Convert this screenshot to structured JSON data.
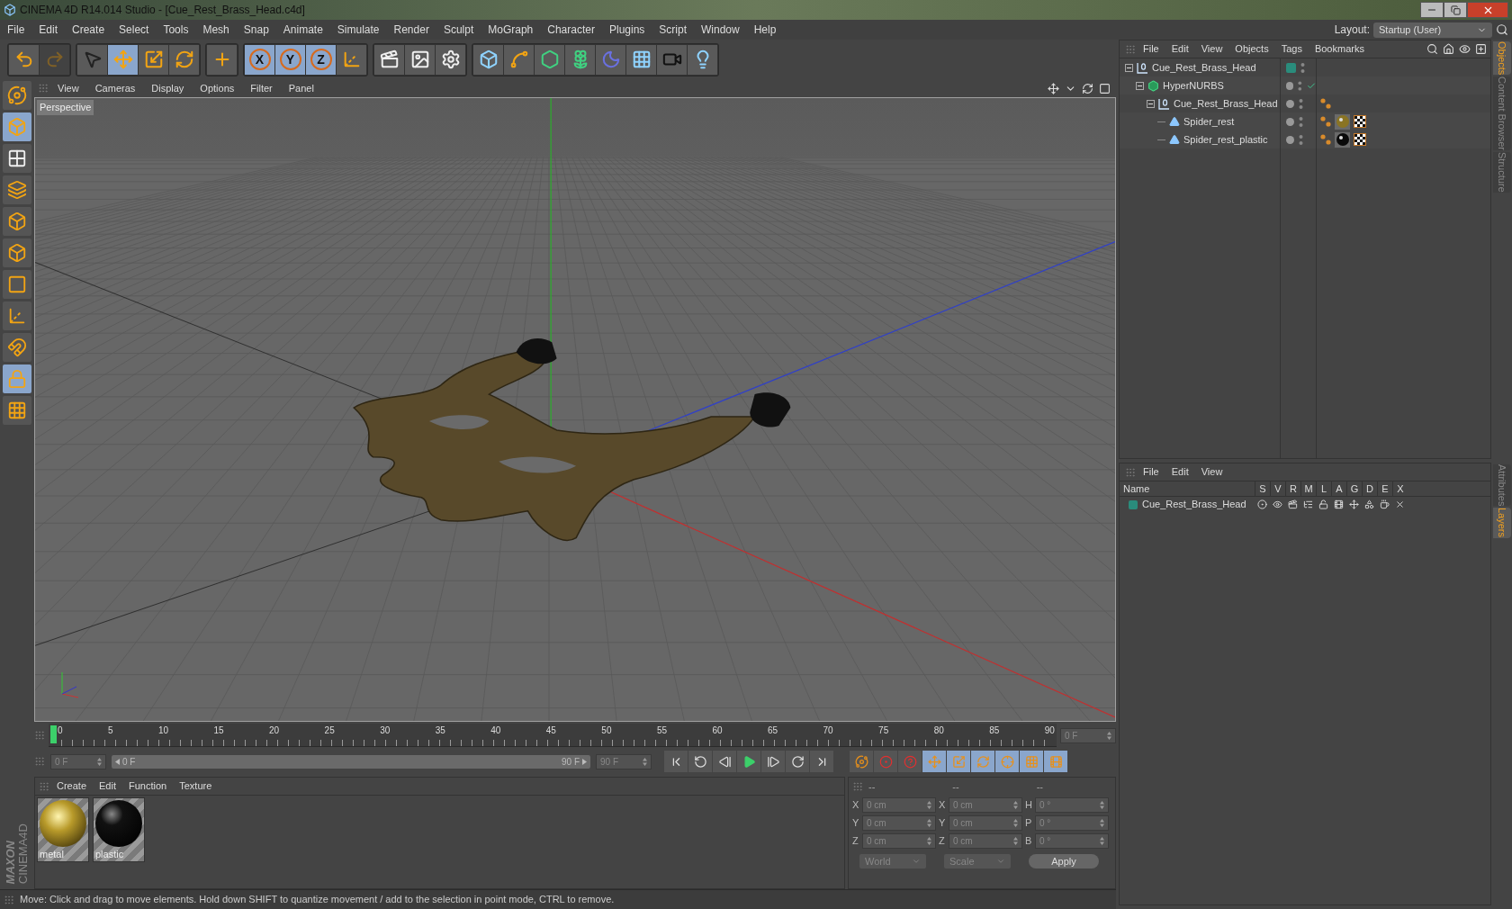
{
  "window": {
    "title": "CINEMA 4D R14.014 Studio - [Cue_Rest_Brass_Head.c4d]"
  },
  "menu": [
    "File",
    "Edit",
    "Create",
    "Select",
    "Tools",
    "Mesh",
    "Snap",
    "Animate",
    "Simulate",
    "Render",
    "Sculpt",
    "MoGraph",
    "Character",
    "Plugins",
    "Script",
    "Window",
    "Help"
  ],
  "layout": {
    "label": "Layout:",
    "value": "Startup (User)"
  },
  "toolbar": [
    [
      {
        "kind": "undo",
        "disabled": false
      },
      {
        "kind": "redo",
        "disabled": true
      }
    ],
    [
      {
        "kind": "select",
        "selected": false
      },
      {
        "kind": "move",
        "selected": true
      },
      {
        "kind": "scale",
        "selected": false
      },
      {
        "kind": "rotate",
        "selected": false
      }
    ],
    [
      {
        "kind": "last_tool",
        "selected": false
      }
    ],
    [
      {
        "kind": "axis",
        "label": "X",
        "selected": true
      },
      {
        "kind": "axis",
        "label": "Y",
        "selected": true
      },
      {
        "kind": "axis",
        "label": "Z",
        "selected": true
      },
      {
        "kind": "coords",
        "selected": false
      }
    ],
    [
      {
        "kind": "render_view",
        "selected": false
      },
      {
        "kind": "render_picture",
        "selected": false
      },
      {
        "kind": "render_settings",
        "selected": false
      }
    ],
    [
      {
        "kind": "cube",
        "selected": false
      },
      {
        "kind": "spline",
        "selected": false
      },
      {
        "kind": "nurbs",
        "selected": false
      },
      {
        "kind": "cloner",
        "selected": false
      },
      {
        "kind": "deformer",
        "selected": false
      },
      {
        "kind": "floor",
        "selected": false
      },
      {
        "kind": "camera",
        "selected": false
      },
      {
        "kind": "light",
        "selected": false
      }
    ]
  ],
  "mode_toolbar": [
    {
      "kind": "make_editable",
      "selected": false
    },
    {
      "kind": "model",
      "selected": true
    },
    {
      "kind": "texture",
      "selected": false
    },
    {
      "kind": "workplane",
      "selected": false
    },
    {
      "kind": "points",
      "selected": false
    },
    {
      "kind": "edges",
      "selected": false
    },
    {
      "kind": "polygons",
      "selected": false
    },
    {
      "kind": "axis",
      "selected": false
    },
    {
      "kind": "snap",
      "selected": false
    },
    {
      "kind": "lock_workplane",
      "selected": true
    },
    {
      "kind": "planar",
      "selected": false
    }
  ],
  "logo": {
    "brand": "MAXON",
    "product": "CINEMA4D"
  },
  "viewport": {
    "menu": [
      "View",
      "Cameras",
      "Display",
      "Options",
      "Filter",
      "Panel"
    ],
    "camera": "Perspective"
  },
  "timeline": {
    "ticks": [
      "0",
      "5",
      "10",
      "15",
      "20",
      "25",
      "30",
      "35",
      "40",
      "45",
      "50",
      "55",
      "60",
      "65",
      "70",
      "75",
      "80",
      "85",
      "90"
    ],
    "level": 0,
    "current_frame": "0 F",
    "start": "0 F",
    "preview_range": {
      "start": "0 F",
      "end": "90 F",
      "level": 1
    },
    "end": "90 F"
  },
  "transport": [
    {
      "kind": "first"
    },
    {
      "kind": "prev_key"
    },
    {
      "kind": "prev_frame"
    },
    {
      "kind": "play"
    },
    {
      "kind": "next_frame"
    },
    {
      "kind": "next_key"
    },
    {
      "kind": "last"
    }
  ],
  "anim_tools": [
    {
      "kind": "motion",
      "selected": false
    },
    {
      "kind": "record",
      "selected": false
    },
    {
      "kind": "help",
      "selected": false
    },
    {
      "kind": "pos",
      "selected": true
    },
    {
      "kind": "scale",
      "selected": true
    },
    {
      "kind": "rot",
      "selected": true
    },
    {
      "kind": "param",
      "selected": true
    },
    {
      "kind": "pla",
      "selected": true
    },
    {
      "kind": "timeline",
      "selected": true
    }
  ],
  "material_manager": {
    "menu": [
      "Create",
      "Edit",
      "Function",
      "Texture"
    ],
    "materials": [
      {
        "name": "metal",
        "kind": "metal"
      },
      {
        "name": "plastic",
        "kind": "plastic"
      }
    ]
  },
  "coordinates": {
    "headers": [
      "--",
      "--",
      "--"
    ],
    "rows": [
      {
        "labels": [
          "X",
          "X",
          "H"
        ],
        "values": [
          "0 cm",
          "0 cm",
          "0 °"
        ]
      },
      {
        "labels": [
          "Y",
          "Y",
          "P"
        ],
        "values": [
          "0 cm",
          "0 cm",
          "0 °"
        ]
      },
      {
        "labels": [
          "Z",
          "Z",
          "B"
        ],
        "values": [
          "0 cm",
          "0 cm",
          "0 °"
        ]
      }
    ],
    "dropdowns": [
      "World",
      "Scale"
    ],
    "apply": "Apply"
  },
  "status_bar": "Move: Click and drag to move elements. Hold down SHIFT to quantize movement / add to the selection in point mode, CTRL to remove.",
  "object_manager": {
    "menu": [
      "File",
      "Edit",
      "View",
      "Objects",
      "Tags",
      "Bookmarks"
    ],
    "objects": [
      {
        "name": "Cue_Rest_Brass_Head",
        "kind": "null",
        "color": "#2a8c7c",
        "expanded": true,
        "children": [
          {
            "name": "HyperNURBS",
            "kind": "nurbs",
            "enabled": true,
            "expanded": true,
            "children": [
              {
                "name": "Cue_Rest_Brass_Head",
                "kind": "null",
                "expanded": true,
                "tags": [
                  {
                    "kind": "phong"
                  }
                ],
                "children": [
                  {
                    "name": "Spider_rest",
                    "kind": "polygon",
                    "tags": [
                      {
                        "kind": "phong"
                      },
                      {
                        "kind": "material",
                        "color": "#8a7424"
                      },
                      {
                        "kind": "texture"
                      }
                    ]
                  },
                  {
                    "name": "Spider_rest_plastic",
                    "kind": "polygon",
                    "tags": [
                      {
                        "kind": "phong"
                      },
                      {
                        "kind": "material",
                        "color": "#0a0a0a"
                      },
                      {
                        "kind": "texture"
                      }
                    ]
                  }
                ]
              }
            ]
          }
        ]
      }
    ]
  },
  "layer_manager": {
    "menu": [
      "File",
      "Edit",
      "View"
    ],
    "columns": [
      "Name",
      "S",
      "V",
      "R",
      "M",
      "L",
      "A",
      "G",
      "D",
      "E",
      "X"
    ],
    "layers": [
      {
        "name": "Cue_Rest_Brass_Head",
        "color": "#2a8c7c"
      }
    ]
  },
  "side_tabs_upper": [
    {
      "label": "Objects",
      "selected": true
    },
    {
      "label": "Content Browser",
      "selected": false
    },
    {
      "label": "Structure",
      "selected": false
    }
  ],
  "side_tabs_lower": [
    {
      "label": "Attributes",
      "selected": false
    },
    {
      "label": "Layers",
      "selected": true
    }
  ]
}
